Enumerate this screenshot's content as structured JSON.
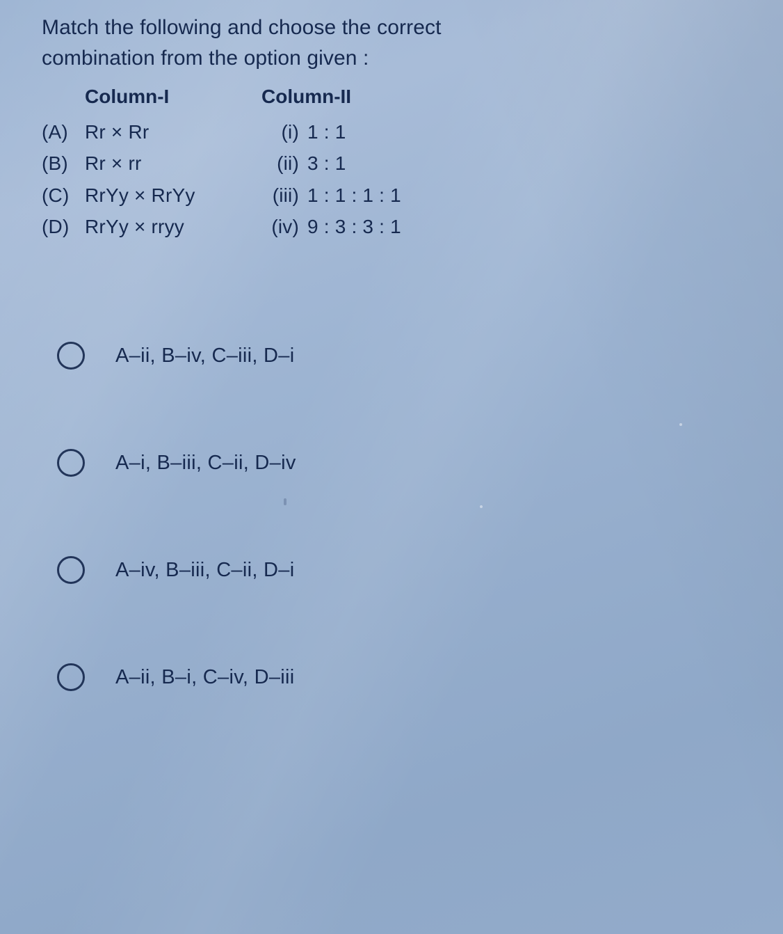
{
  "question": {
    "line1": "Match the following and choose the correct",
    "line2": "combination from the option given :"
  },
  "table": {
    "col1_header": "Column-I",
    "col2_header": "Column-II",
    "rows": [
      {
        "tag": "(A)",
        "cross": "Rr × Rr",
        "num": "(i)",
        "ratio": "1 : 1"
      },
      {
        "tag": "(B)",
        "cross": "Rr × rr",
        "num": "(ii)",
        "ratio": "3 : 1"
      },
      {
        "tag": "(C)",
        "cross": "RrYy × RrYy",
        "num": "(iii)",
        "ratio": "1 : 1 : 1 : 1"
      },
      {
        "tag": "(D)",
        "cross": "RrYy × rryy",
        "num": "(iv)",
        "ratio": "9 : 3 : 3 : 1"
      }
    ]
  },
  "options": [
    {
      "label": "A–ii, B–iv, C–iii, D–i"
    },
    {
      "label": "A–i, B–iii, C–ii, D–iv"
    },
    {
      "label": "A–iv, B–iii, C–ii, D–i"
    },
    {
      "label": "A–ii, B–i, C–iv, D–iii"
    }
  ],
  "colors": {
    "text": "#16294f",
    "background_top": "#9fb6d4",
    "background_bottom": "#93abca"
  }
}
